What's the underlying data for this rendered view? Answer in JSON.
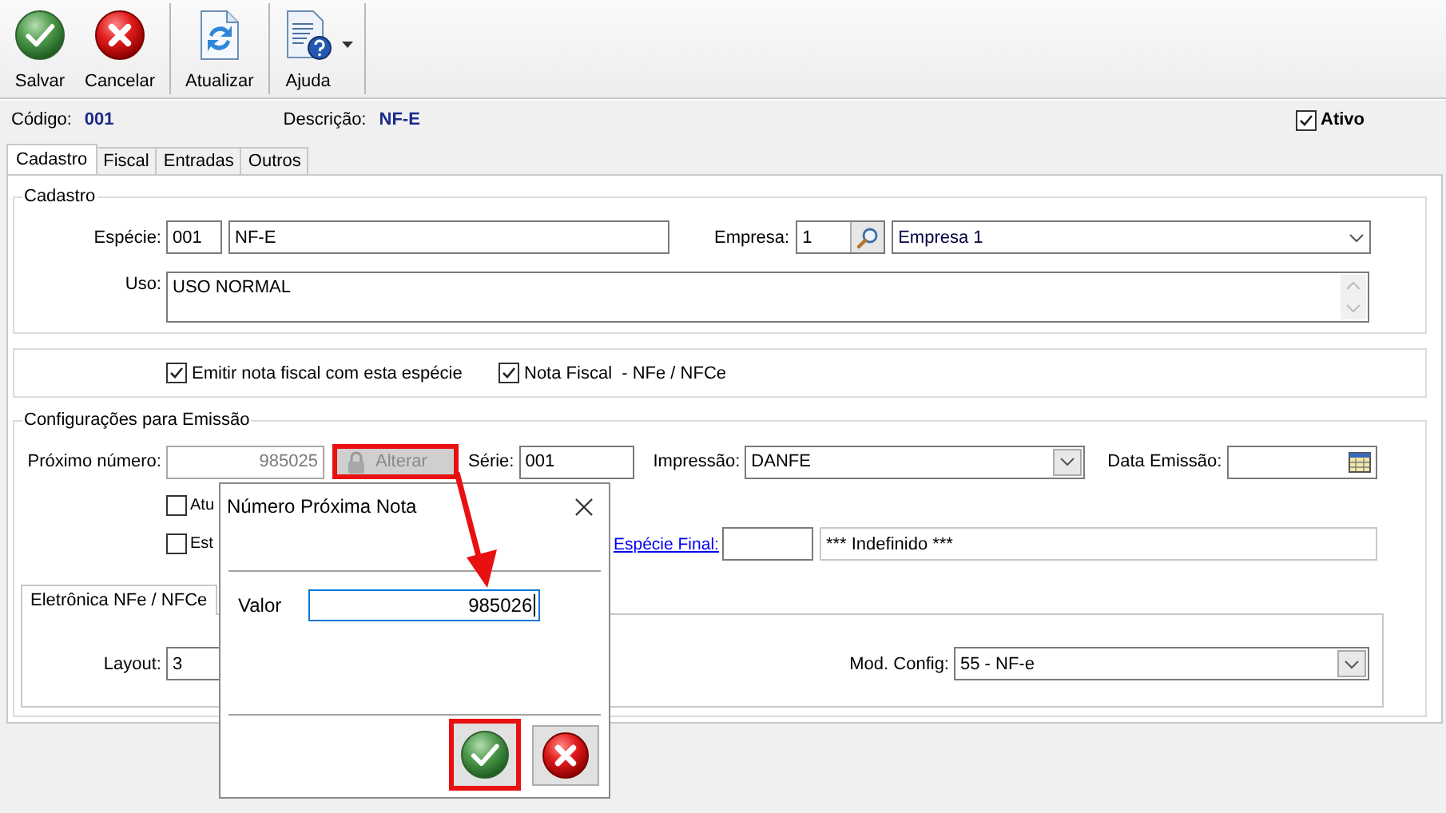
{
  "toolbar": {
    "buttons": [
      {
        "kind": "save",
        "label": "Salvar",
        "has_menu": false
      },
      {
        "kind": "cancel",
        "label": "Cancelar",
        "has_menu": false
      },
      {
        "kind": "refresh",
        "label": "Atualizar",
        "has_menu": false
      },
      {
        "kind": "help",
        "label": "Ajuda",
        "has_menu": true
      }
    ]
  },
  "header": {
    "code_label": "Código:",
    "code": "001",
    "description_label": "Descrição:",
    "description": "NF-E",
    "active": {
      "label": "Ativo",
      "checked": true
    }
  },
  "tabs": [
    {
      "label": "Cadastro",
      "selected": true
    },
    {
      "label": "Fiscal",
      "selected": false
    },
    {
      "label": "Entradas",
      "selected": false
    },
    {
      "label": "Outros",
      "selected": false
    }
  ],
  "cadastro": {
    "title": "Cadastro",
    "especie_label": "Espécie:",
    "especie_code": "001",
    "especie_name": "NF-E",
    "empresa_label": "Empresa:",
    "empresa_code": "1",
    "empresa_name": "Empresa 1",
    "uso_label": "Uso:",
    "uso": "USO NORMAL"
  },
  "options": [
    {
      "label": "Emitir nota fiscal com esta espécie",
      "checked": true
    },
    {
      "label": "Nota Fiscal  - NFe / NFCe",
      "checked": true
    }
  ],
  "emissao": {
    "title": "Configurações para Emissão",
    "proximo_label": "Próximo número:",
    "proximo": "985025",
    "alterar": {
      "label": "Alterar",
      "disabled": true,
      "highlighted": true
    },
    "serie_label": "Série:",
    "serie": "001",
    "impressao_label": "Impressão:",
    "impressao": "DANFE",
    "data_label": "Data Emissão:",
    "checks": [
      {
        "label": "Atu",
        "checked": false
      },
      {
        "label": "Est",
        "checked": false
      }
    ],
    "especie_final_label": "Espécie Final:",
    "especie_final_name": "*** Indefinido ***",
    "subtabs": [
      {
        "label": "Eletrônica NFe / NFCe",
        "selected": true
      }
    ],
    "layout_label": "Layout:",
    "layout": "3",
    "mod_label": "Mod. Config:",
    "mod": "55 - NF-e"
  },
  "dialog": {
    "title": "Número Próxima Nota",
    "valor_label": "Valor",
    "valor": "985026",
    "ok": {
      "highlighted": true
    }
  }
}
